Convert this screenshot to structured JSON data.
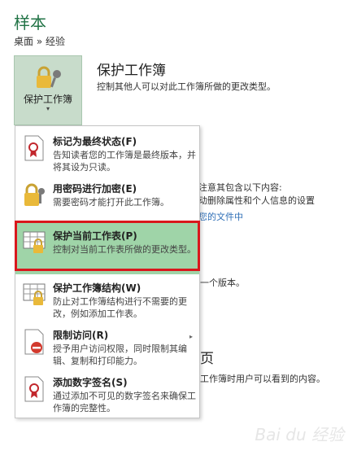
{
  "page": {
    "title": "样本",
    "breadcrumb": "桌面 » 经验"
  },
  "protect_button": {
    "label": "保护工作簿",
    "arrow": "▾"
  },
  "section": {
    "heading": "保护工作簿",
    "description": "控制其他人可以对此工作簿所做的更改类型。"
  },
  "background": {
    "inspect_line1": "注意其包含以下内容:",
    "inspect_line2": "动删除属性和个人信息的设置",
    "inspect_link": "您的文件中",
    "versions": "一个版本。",
    "big_char": "页",
    "browser_line": "工作簿时用户可以看到的内容。"
  },
  "menu": {
    "items": [
      {
        "title": "标记为最终状态(F)",
        "subtitle": "告知读者您的工作簿是最终版本，并将其设为只读。"
      },
      {
        "title": "用密码进行加密(E)",
        "subtitle": "需要密码才能打开此工作簿。"
      },
      {
        "title": "保护当前工作表(P)",
        "subtitle": "控制对当前工作表所做的更改类型。"
      },
      {
        "title": "保护工作簿结构(W)",
        "subtitle": "防止对工作簿结构进行不需要的更改，例如添加工作表。"
      },
      {
        "title": "限制访问(R)",
        "subtitle": "授予用户访问权限，同时限制其编辑、复制和打印能力。",
        "arrow": "▸"
      },
      {
        "title": "添加数字签名(S)",
        "subtitle": "通过添加不可见的数字签名来确保工作簿的完整性。"
      }
    ]
  },
  "watermark": "Bai du 经验",
  "colors": {
    "accent": "#217346",
    "selected": "#9fd4a8",
    "highlight_border": "#d9171c",
    "link": "#2f6fb7"
  },
  "icons": [
    "lock-key-icon",
    "ribbon-document-icon",
    "key-lock-icon",
    "sheet-lock-icon",
    "workbook-lock-icon",
    "no-access-icon",
    "signature-ribbon-icon"
  ]
}
